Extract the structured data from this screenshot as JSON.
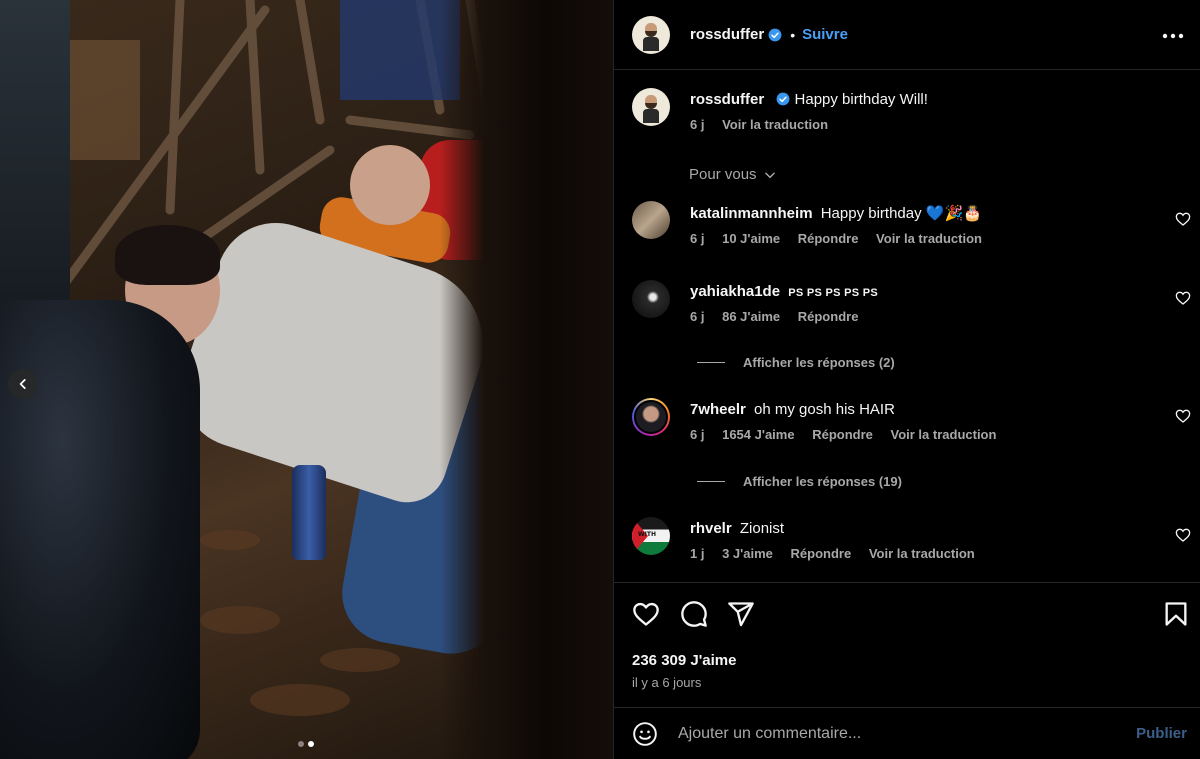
{
  "post": {
    "author": "rossduffer",
    "follow_label": "Suivre",
    "bullet": "•",
    "caption": "Happy birthday Will!",
    "caption_age": "6 j",
    "caption_translate": "Voir la traduction",
    "section_label": "Pour vous"
  },
  "comments": [
    {
      "user": "katalinmannheim",
      "text": "Happy birthday 💙🎉🎂",
      "age": "6 j",
      "likes": "10 J'aime",
      "reply": "Répondre",
      "translate": "Voir la traduction"
    },
    {
      "user": "yahiakha1de",
      "text": "PS PS PS PS PS",
      "age": "6 j",
      "likes": "86 J'aime",
      "reply": "Répondre",
      "replies_label": "Afficher les réponses (2)"
    },
    {
      "user": "7wheelr",
      "text": "oh my gosh his HAIR",
      "age": "6 j",
      "likes": "1654 J'aime",
      "reply": "Répondre",
      "translate": "Voir la traduction",
      "replies_label": "Afficher les réponses (19)"
    },
    {
      "user": "rhvelr",
      "text": "Zionist",
      "age": "1 j",
      "likes": "3 J'aime",
      "reply": "Répondre",
      "translate": "Voir la traduction",
      "avatar_text": "WITH"
    }
  ],
  "footer": {
    "likes_count": "236 309 J'aime",
    "posted": "il y a 6 jours",
    "comment_placeholder": "Ajouter un commentaire...",
    "publish_label": "Publier"
  },
  "carousel": {
    "slide_count": 2,
    "active_slide": 2
  },
  "colors": {
    "accent": "#4a9ef5",
    "muted": "#a8a8a8",
    "publish_disabled": "#3b5f8a",
    "background": "#000000"
  },
  "icons": [
    "chevron-left-icon",
    "verified-badge-icon",
    "more-options-icon",
    "chevron-down-icon",
    "heart-icon",
    "comment-icon",
    "share-icon",
    "bookmark-icon",
    "emoji-icon"
  ]
}
